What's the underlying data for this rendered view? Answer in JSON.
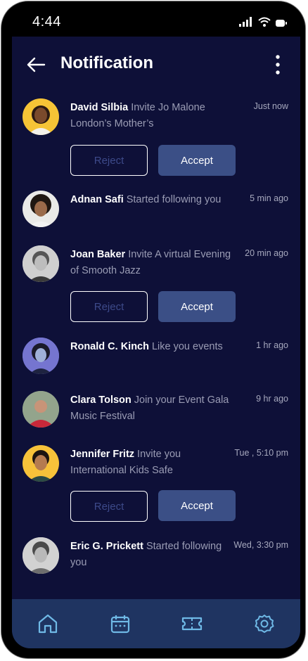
{
  "status_bar": {
    "time": "4:44"
  },
  "header": {
    "title": "Notification"
  },
  "notifications": [
    {
      "name": "David Silbia",
      "message": "Invite Jo Malone London’s Mother’s",
      "time": "Just now",
      "actions": true
    },
    {
      "name": "Adnan Safi",
      "message": "Started following you",
      "time": "5 min ago",
      "actions": false
    },
    {
      "name": "Joan Baker",
      "message": "Invite A virtual Evening of Smooth Jazz",
      "time": "20 min ago",
      "actions": true
    },
    {
      "name": "Ronald C. Kinch",
      "message": "Like you events",
      "time": "1 hr ago",
      "actions": false
    },
    {
      "name": "Clara Tolson",
      "message": "Join your Event Gala Music Festival",
      "time": "9 hr ago",
      "actions": false
    },
    {
      "name": "Jennifer Fritz",
      "message": "Invite you International Kids Safe",
      "time": "Tue , 5:10 pm",
      "actions": true
    },
    {
      "name": "Eric G. Prickett",
      "message": "Started following you",
      "time": "Wed, 3:30 pm",
      "actions": false
    }
  ],
  "buttons": {
    "reject": "Reject",
    "accept": "Accept"
  },
  "bottom_nav": [
    "home-icon",
    "calendar-icon",
    "ticket-icon",
    "settings-icon"
  ],
  "colors": {
    "background": "#0e1038",
    "accent": "#3b4f86",
    "nav": "#1f3461",
    "icon": "#6fb9e6"
  }
}
